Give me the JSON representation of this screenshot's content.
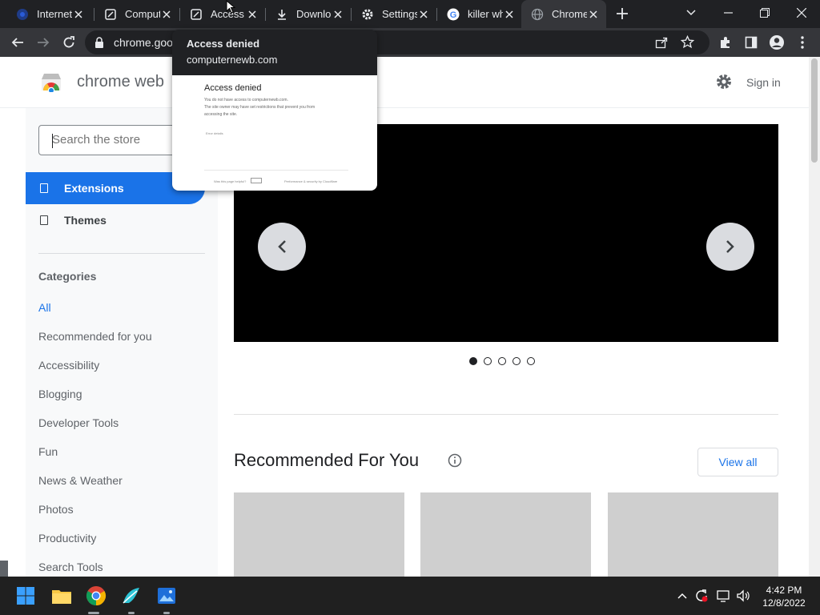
{
  "browser": {
    "tabs": [
      {
        "title": "Internet",
        "icon": "edge-style-favicon",
        "active": false
      },
      {
        "title": "Comput",
        "icon": "site-favicon",
        "active": false
      },
      {
        "title": "Access d",
        "icon": "site-favicon",
        "active": false
      },
      {
        "title": "Downlo",
        "icon": "download-icon",
        "active": false
      },
      {
        "title": "Settings",
        "icon": "settings-gear-icon",
        "active": false
      },
      {
        "title": "killer wh",
        "icon": "google-icon",
        "active": false
      },
      {
        "title": "Chrome",
        "icon": "globe-icon",
        "active": true
      }
    ],
    "url": "chrome.goo",
    "hovercard": {
      "title": "Access denied",
      "domain": "computernewb.com",
      "preview_title": "Access denied",
      "preview_line1": "You do not have access to computernewb.com.",
      "preview_line2": "The site owner may have set restrictions that prevent you from",
      "preview_line3": "accessing the site.",
      "preview_details": "Error details",
      "preview_helpful": "Was this page helpful?",
      "preview_footer": "Performance & security by Cloudflare"
    }
  },
  "store": {
    "title": "chrome web",
    "sign_in": "Sign in",
    "search_placeholder": "Search the store",
    "nav": [
      {
        "label": "Extensions",
        "active": true
      },
      {
        "label": "Themes",
        "active": false
      }
    ],
    "categories_heading": "Categories",
    "categories": [
      "All",
      "Recommended for you",
      "Accessibility",
      "Blogging",
      "Developer Tools",
      "Fun",
      "News & Weather",
      "Photos",
      "Productivity",
      "Search Tools"
    ],
    "carousel_dots": 5,
    "carousel_active_dot": 0,
    "recommended_title": "Recommended For You",
    "view_all": "View all"
  },
  "taskbar": {
    "time": "4:42 PM",
    "date": "12/8/2022"
  },
  "colors": {
    "accent": "#1a73e8",
    "tabstrip": "#202124",
    "toolbar": "#35363a",
    "taskbar": "#202020"
  }
}
